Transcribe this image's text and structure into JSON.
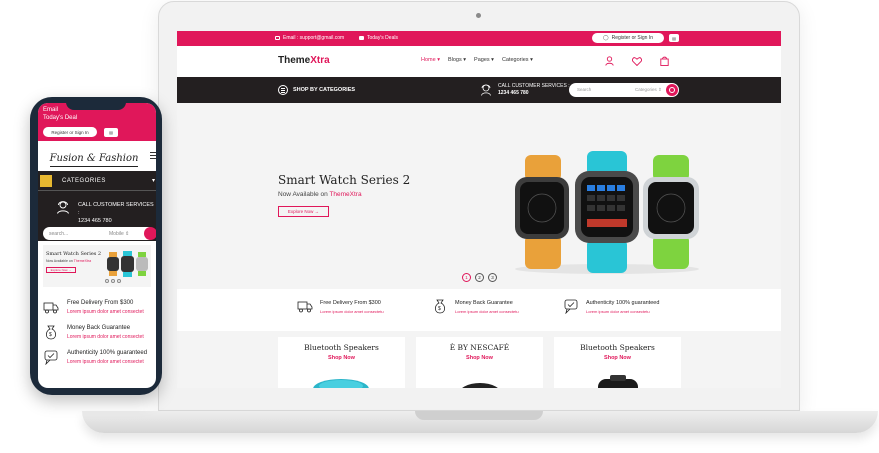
{
  "laptop": {
    "topbar": {
      "email": "Email : support@gmail.com",
      "deals": "Today's Deals",
      "signin": "Register or Sign In"
    },
    "header": {
      "logo_main": "Theme",
      "logo_accent": "Xtra",
      "nav": [
        "Home",
        "Blogs",
        "Pages",
        "Categories"
      ]
    },
    "catbar": {
      "shop_label": "SHOP BY CATEGORIES",
      "call_label": "CALL CUSTOMER SERVICES :",
      "call_number": "1234 465 780",
      "search_placeholder": "Search",
      "search_category": "Categories"
    },
    "hero": {
      "title": "Smart Watch Series 2",
      "subtitle_prefix": "Now Available on ",
      "subtitle_brand": "ThemeXtra",
      "button": "Explore Now →",
      "slides": [
        "1",
        "2",
        "3"
      ]
    },
    "features": [
      {
        "title": "Free Delivery From $300",
        "desc": "Lorem ipsum dolor amet consectetu"
      },
      {
        "title": "Money Back Guarantee",
        "desc": "Lorem ipsum dolor amet consectetu"
      },
      {
        "title": "Authenticity 100% guaranteed",
        "desc": "Lorem ipsum dolor amet consectetu"
      }
    ],
    "products": [
      {
        "name": "Bluetooth Speakers",
        "cta": "Shop Now"
      },
      {
        "name": "È BY NESCAFÉ",
        "cta": "Shop Now"
      },
      {
        "name": "Bluetooth Speakers",
        "cta": "Shop Now"
      }
    ]
  },
  "phone": {
    "email": "Email",
    "deals": "Today's Deal",
    "signin": "Register or Sign In",
    "logo": "Fusion & Fashion",
    "categories": "CATEGORIES",
    "call_label": "CALL CUSTOMER SERVICES :",
    "call_number": "1234 465 780",
    "search_placeholder": "search...",
    "search_category": "Mobile",
    "banner_title": "Smart Watch Series 2",
    "banner_sub_prefix": "Now Available on ",
    "banner_sub_brand": "ThemeXtra",
    "banner_button": "Explore Now →",
    "features": [
      {
        "title": "Free Delivery From $300",
        "desc": "Lorem ipsum dolor amet consectet"
      },
      {
        "title": "Money Back Guarantee",
        "desc": "Lorem ipsum dolor amet consectet"
      },
      {
        "title": "Authenticity 100% guaranteed",
        "desc": "Lorem ipsum dolor amet consectet"
      }
    ]
  },
  "colors": {
    "accent": "#e0175a",
    "dark_bar": "#231f20"
  },
  "icons": [
    "envelope-icon",
    "tag-icon",
    "user-icon",
    "heart-icon",
    "cart-icon",
    "menu-icon",
    "support-icon",
    "search-icon",
    "truck-icon",
    "money-bag-icon",
    "shield-icon"
  ]
}
